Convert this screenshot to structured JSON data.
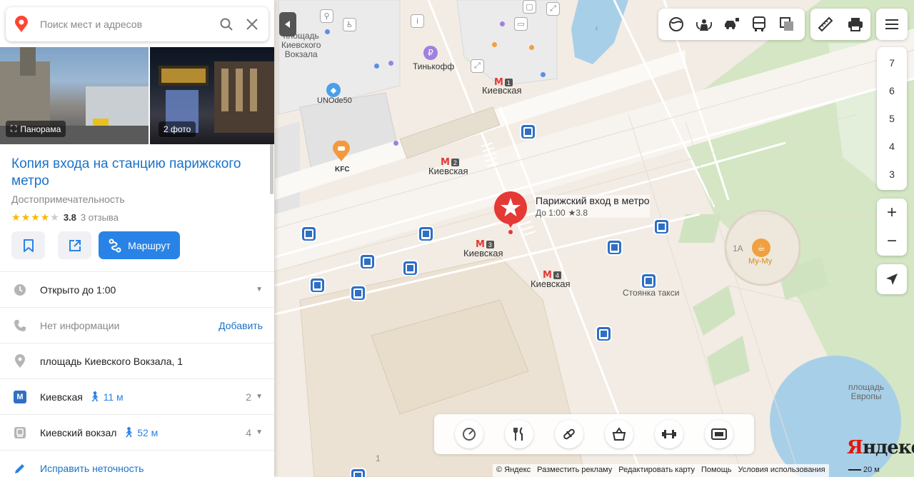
{
  "search": {
    "placeholder": "Поиск мест и адресов"
  },
  "photos": {
    "panorama_label": "Панорама",
    "photos_label": "2 фото"
  },
  "place": {
    "title": "Копия входа на станцию парижского метро",
    "category": "Достопримечательность",
    "rating_value": "3.8",
    "stars_filled": 4,
    "reviews": "3 отзыва"
  },
  "actions": {
    "route_label": "Маршрут"
  },
  "info": {
    "hours": "Открыто до 1:00",
    "phone": "Нет информации",
    "phone_action": "Добавить",
    "address": "площадь Киевского Вокзала, 1",
    "metro_name": "Киевская",
    "metro_walk": "11 м",
    "metro_count": "2",
    "station_name": "Киевский вокзал",
    "station_walk": "52 м",
    "station_count": "4",
    "fix_label": "Исправить неточность"
  },
  "floors": [
    "7",
    "6",
    "5",
    "4",
    "3"
  ],
  "zoom": {
    "plus": "+",
    "minus": "−"
  },
  "map_labels": {
    "square_kv": "площадь\nКиевского\nВокзала",
    "tinkoff": "Тинькофф",
    "unode": "UNOde50",
    "kfc": "KFC",
    "metro_kievskaya": "Киевская",
    "taxi": "Стоянка такси",
    "mumu": "Му-Му",
    "bld_1a": "1А",
    "europe_sq": "площадь\nЕвропы",
    "bld_1": "1",
    "metro_nums": [
      "1",
      "2",
      "3",
      "4"
    ]
  },
  "selected": {
    "name": "Парижский вход в метро",
    "hours": "До 1:00",
    "rating": "★3.8"
  },
  "footer": {
    "links": [
      "© Яндекс",
      "Разместить рекламу",
      "Редактировать карту",
      "Помощь",
      "Условия использования"
    ],
    "scale": "20 м",
    "logo_first": "Я",
    "logo_rest": "ндекс"
  },
  "colors": {
    "accent": "#2983e6",
    "link": "#1a73c8",
    "marker": "#e53935",
    "bus": "#2f6fc4",
    "water": "#a8cfe8",
    "park": "#cfe3c0"
  }
}
